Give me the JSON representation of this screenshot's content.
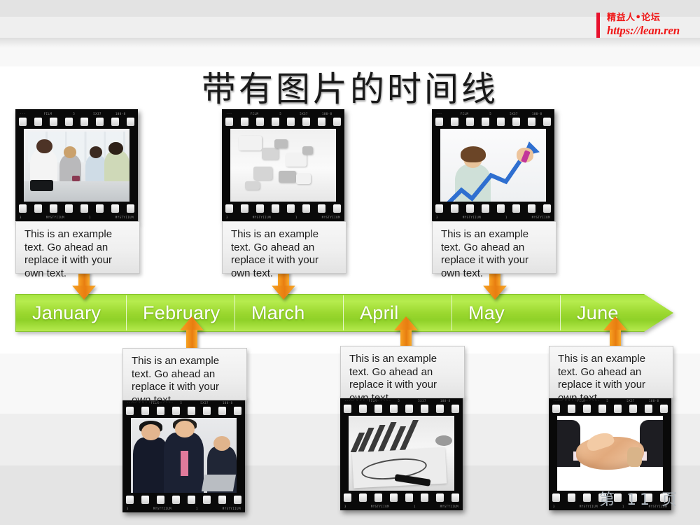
{
  "slide": {
    "title": "带有图片的时间线",
    "page_number": "第 11 页",
    "accent_green": "#9ad72e",
    "accent_orange": "#e87d10",
    "logo_red": "#f01616"
  },
  "logo": {
    "name_cn": "精益人•论坛",
    "url": "https://lean.ren"
  },
  "timeline": {
    "months": [
      {
        "label": "January"
      },
      {
        "label": "February"
      },
      {
        "label": "March"
      },
      {
        "label": "April"
      },
      {
        "label": "May"
      },
      {
        "label": "June"
      }
    ]
  },
  "callouts": [
    {
      "id": "january",
      "text": "This is an example text. Go ahead an replace it with your own text."
    },
    {
      "id": "february",
      "text": "This is an example text. Go ahead an replace it with your own text."
    },
    {
      "id": "march",
      "text": "This is an example text. Go ahead an replace it with your own text."
    },
    {
      "id": "april",
      "text": "This is an example text. Go ahead an replace it with your own text."
    },
    {
      "id": "may",
      "text": "This is an example text. Go ahead an replace it with your own text."
    },
    {
      "id": "june",
      "text": "This is an example text. Go ahead an replace it with your own text."
    }
  ],
  "photos": [
    {
      "id": "january-photo",
      "caption": "business meeting around a table"
    },
    {
      "id": "march-photo",
      "caption": "white puzzle pieces"
    },
    {
      "id": "may-photo",
      "caption": "woman drawing a rising chart arrow"
    },
    {
      "id": "february-photo",
      "caption": "business people with a laptop"
    },
    {
      "id": "april-photo",
      "caption": "printed results chart with a pen"
    },
    {
      "id": "june-photo",
      "caption": "handshake between two people"
    }
  ],
  "film_markings": {
    "top_left": "·--",
    "top_1": "FILM",
    "top_2": "5",
    "top_3": "5X37",
    "top_4": "100-8",
    "bottom_left": "3",
    "bottom_repeat": "MYSTYIIUM",
    "bottom_mid": "1",
    "bottom_right": "MYSTYIIUM"
  }
}
